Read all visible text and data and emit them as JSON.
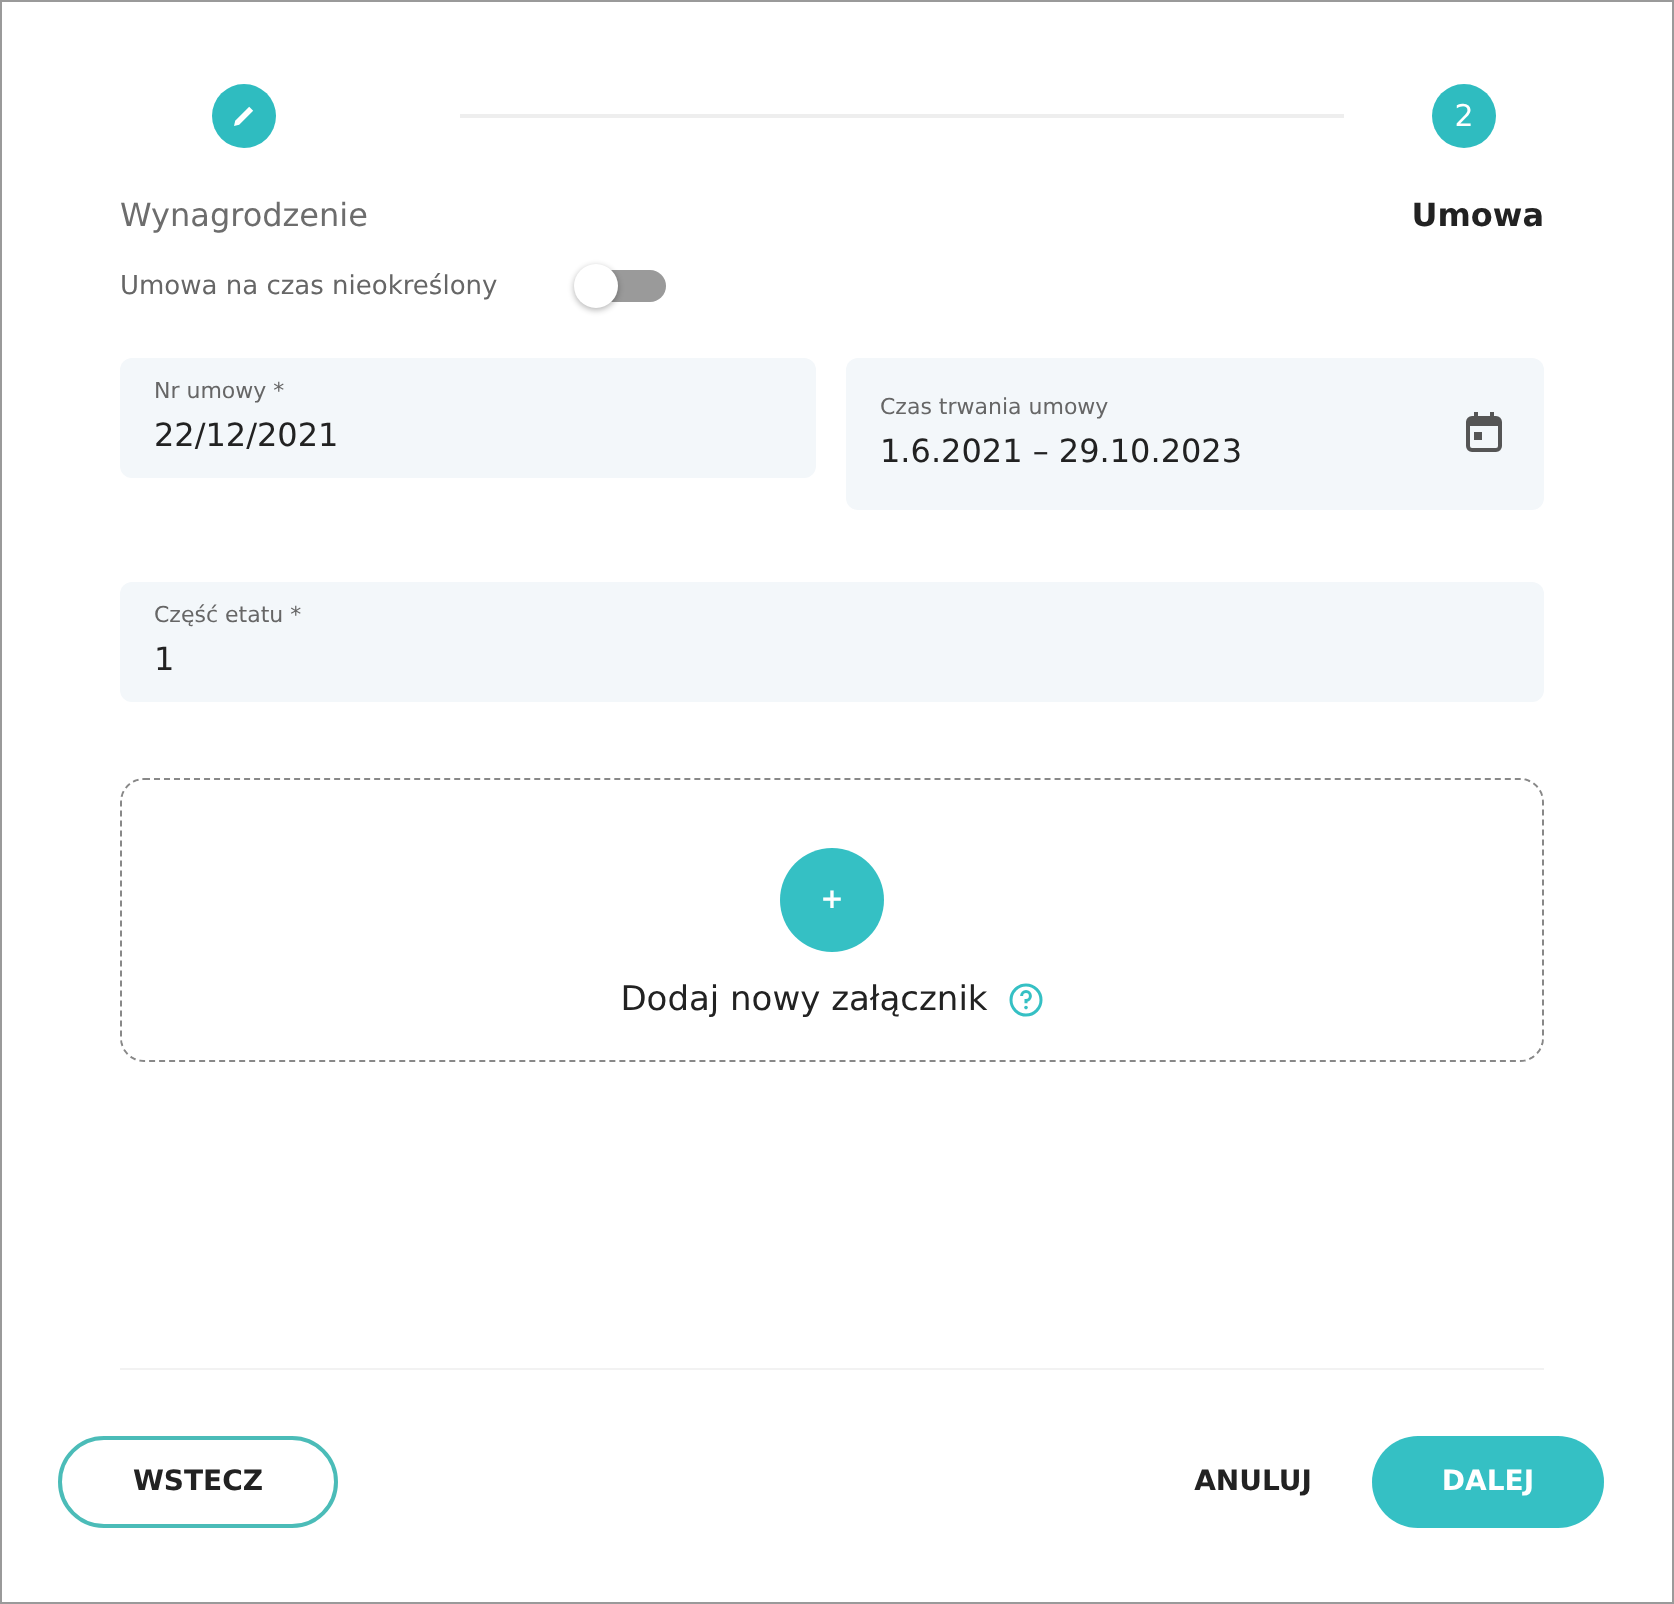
{
  "stepper": {
    "steps": [
      {
        "label": "Wynagrodzenie",
        "kind": "done",
        "selected": false
      },
      {
        "label": "Umowa",
        "kind": "number",
        "number": "2",
        "selected": true
      }
    ]
  },
  "toggle": {
    "label": "Umowa na czas nieokreślony",
    "on": false
  },
  "fields": [
    {
      "label": "Nr umowy *",
      "value": "22/12/2021",
      "kind": "text"
    },
    {
      "label": "Czas trwania umowy",
      "value": "1.6.2021 – 29.10.2023",
      "kind": "date"
    },
    {
      "label": "Część etatu *",
      "value": "1",
      "kind": "text"
    }
  ],
  "upload": {
    "button": "+",
    "label": "Dodaj nowy załącznik"
  },
  "footer": {
    "back": "WSTECZ",
    "cancel": "ANULUJ",
    "next": "DALEJ"
  }
}
